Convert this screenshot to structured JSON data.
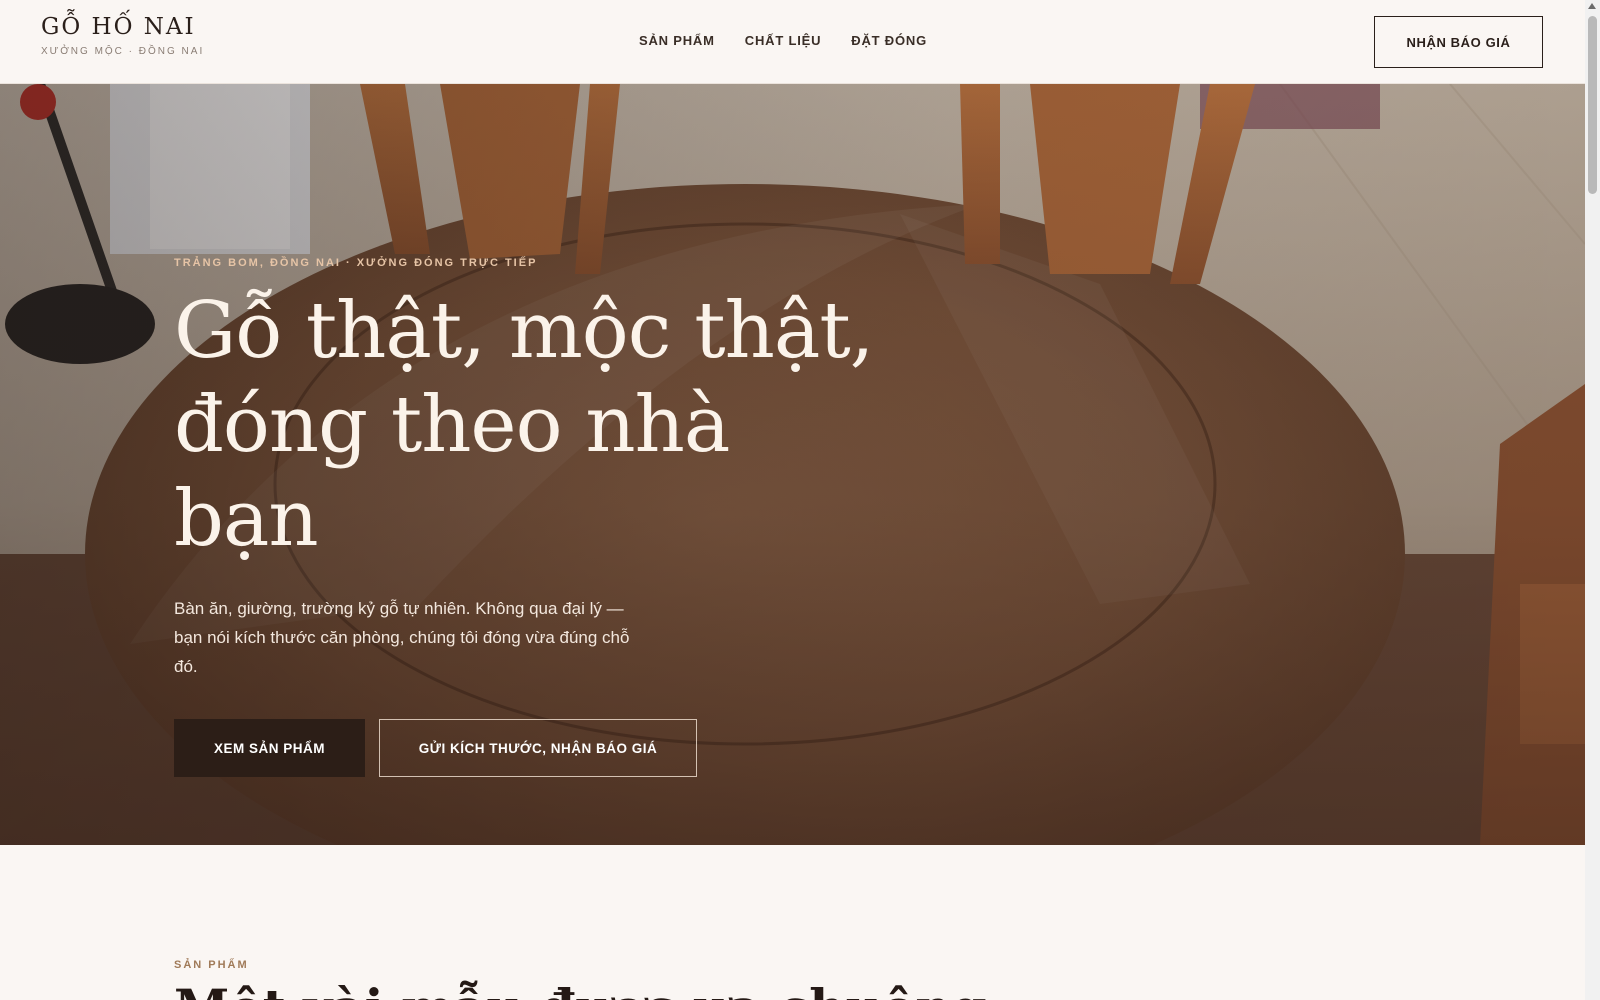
{
  "header": {
    "brand_name": "GỖ HỐ NAI",
    "brand_tagline": "XƯỞNG MỘC · ĐỒNG NAI",
    "nav": [
      {
        "label": "SẢN PHẨM"
      },
      {
        "label": "CHẤT LIỆU"
      },
      {
        "label": "ĐẶT ĐÓNG"
      }
    ],
    "cta_label": "NHẬN BÁO GIÁ"
  },
  "hero": {
    "eyebrow": "TRẢNG BOM, ĐỒNG NAI · XƯỞNG ĐÓNG TRỰC TIẾP",
    "title": "Gỗ thật, mộc thật, đóng theo nhà bạn",
    "subtitle": "Bàn ăn, giường, trường kỷ gỗ tự nhiên. Không qua đại lý — bạn nói kích thước căn phòng, chúng tôi đóng vừa đúng chỗ đó.",
    "primary_button": "XEM SẢN PHẨM",
    "secondary_button": "GỬI KÍCH THƯỚC, NHẬN BÁO GIÁ"
  },
  "products_section": {
    "eyebrow": "SẢN PHẨM",
    "title": "Một vài mẫu được ưa chuộng"
  },
  "colors": {
    "background": "#faf6f3",
    "text_dark": "#2a1f1a",
    "accent": "#a07a58",
    "button_dark": "#2c1e17"
  }
}
